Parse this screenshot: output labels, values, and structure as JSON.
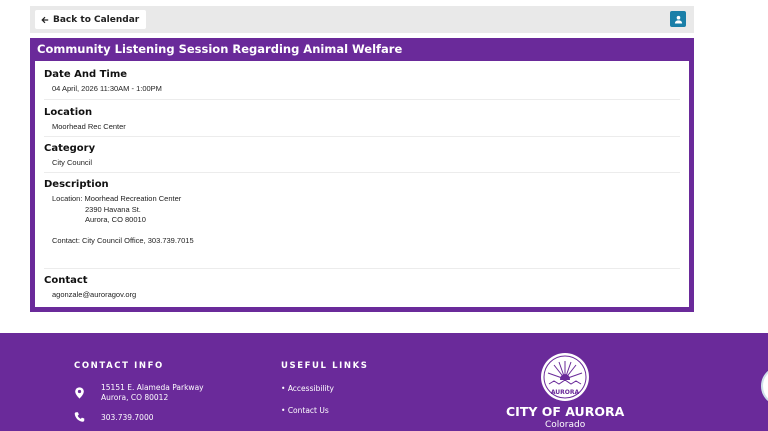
{
  "toolbar": {
    "back_label": "Back to Calendar",
    "back_icon": "arrow-left-icon",
    "account_icon": "user-icon"
  },
  "event": {
    "title": "Community Listening Session Regarding Animal Welfare",
    "date_heading": "Date And Time",
    "date_value": "04 April, 2026 11:30AM - 1:00PM",
    "location_heading": "Location",
    "location_value": "Moorhead Rec Center",
    "category_heading": "Category",
    "category_value": "City Council",
    "description_heading": "Description",
    "description_lines": [
      "Location: Moorhead Recreation Center",
      "2390 Havana St.",
      "Aurora, CO 80010",
      "Contact: City Council Office, 303.739.7015"
    ],
    "contact_heading": "Contact",
    "contact_value": "agonzale@auroragov.org"
  },
  "footer": {
    "contact_heading": "CONTACT INFO",
    "address_line1": "15151 E. Alameda Parkway",
    "address_line2": "Aurora, CO 80012",
    "phone": "303.739.7000",
    "links_heading": "USEFUL LINKS",
    "links": [
      "Accessibility",
      "Contact Us"
    ],
    "logo_text": "AURORA",
    "city_name": "CITY OF AURORA",
    "city_subtitle": "Colorado"
  },
  "colors": {
    "brand_purple": "#6a2a9a",
    "account_button": "#1a7fa8",
    "toolbar_bg": "#e9e9e9"
  }
}
